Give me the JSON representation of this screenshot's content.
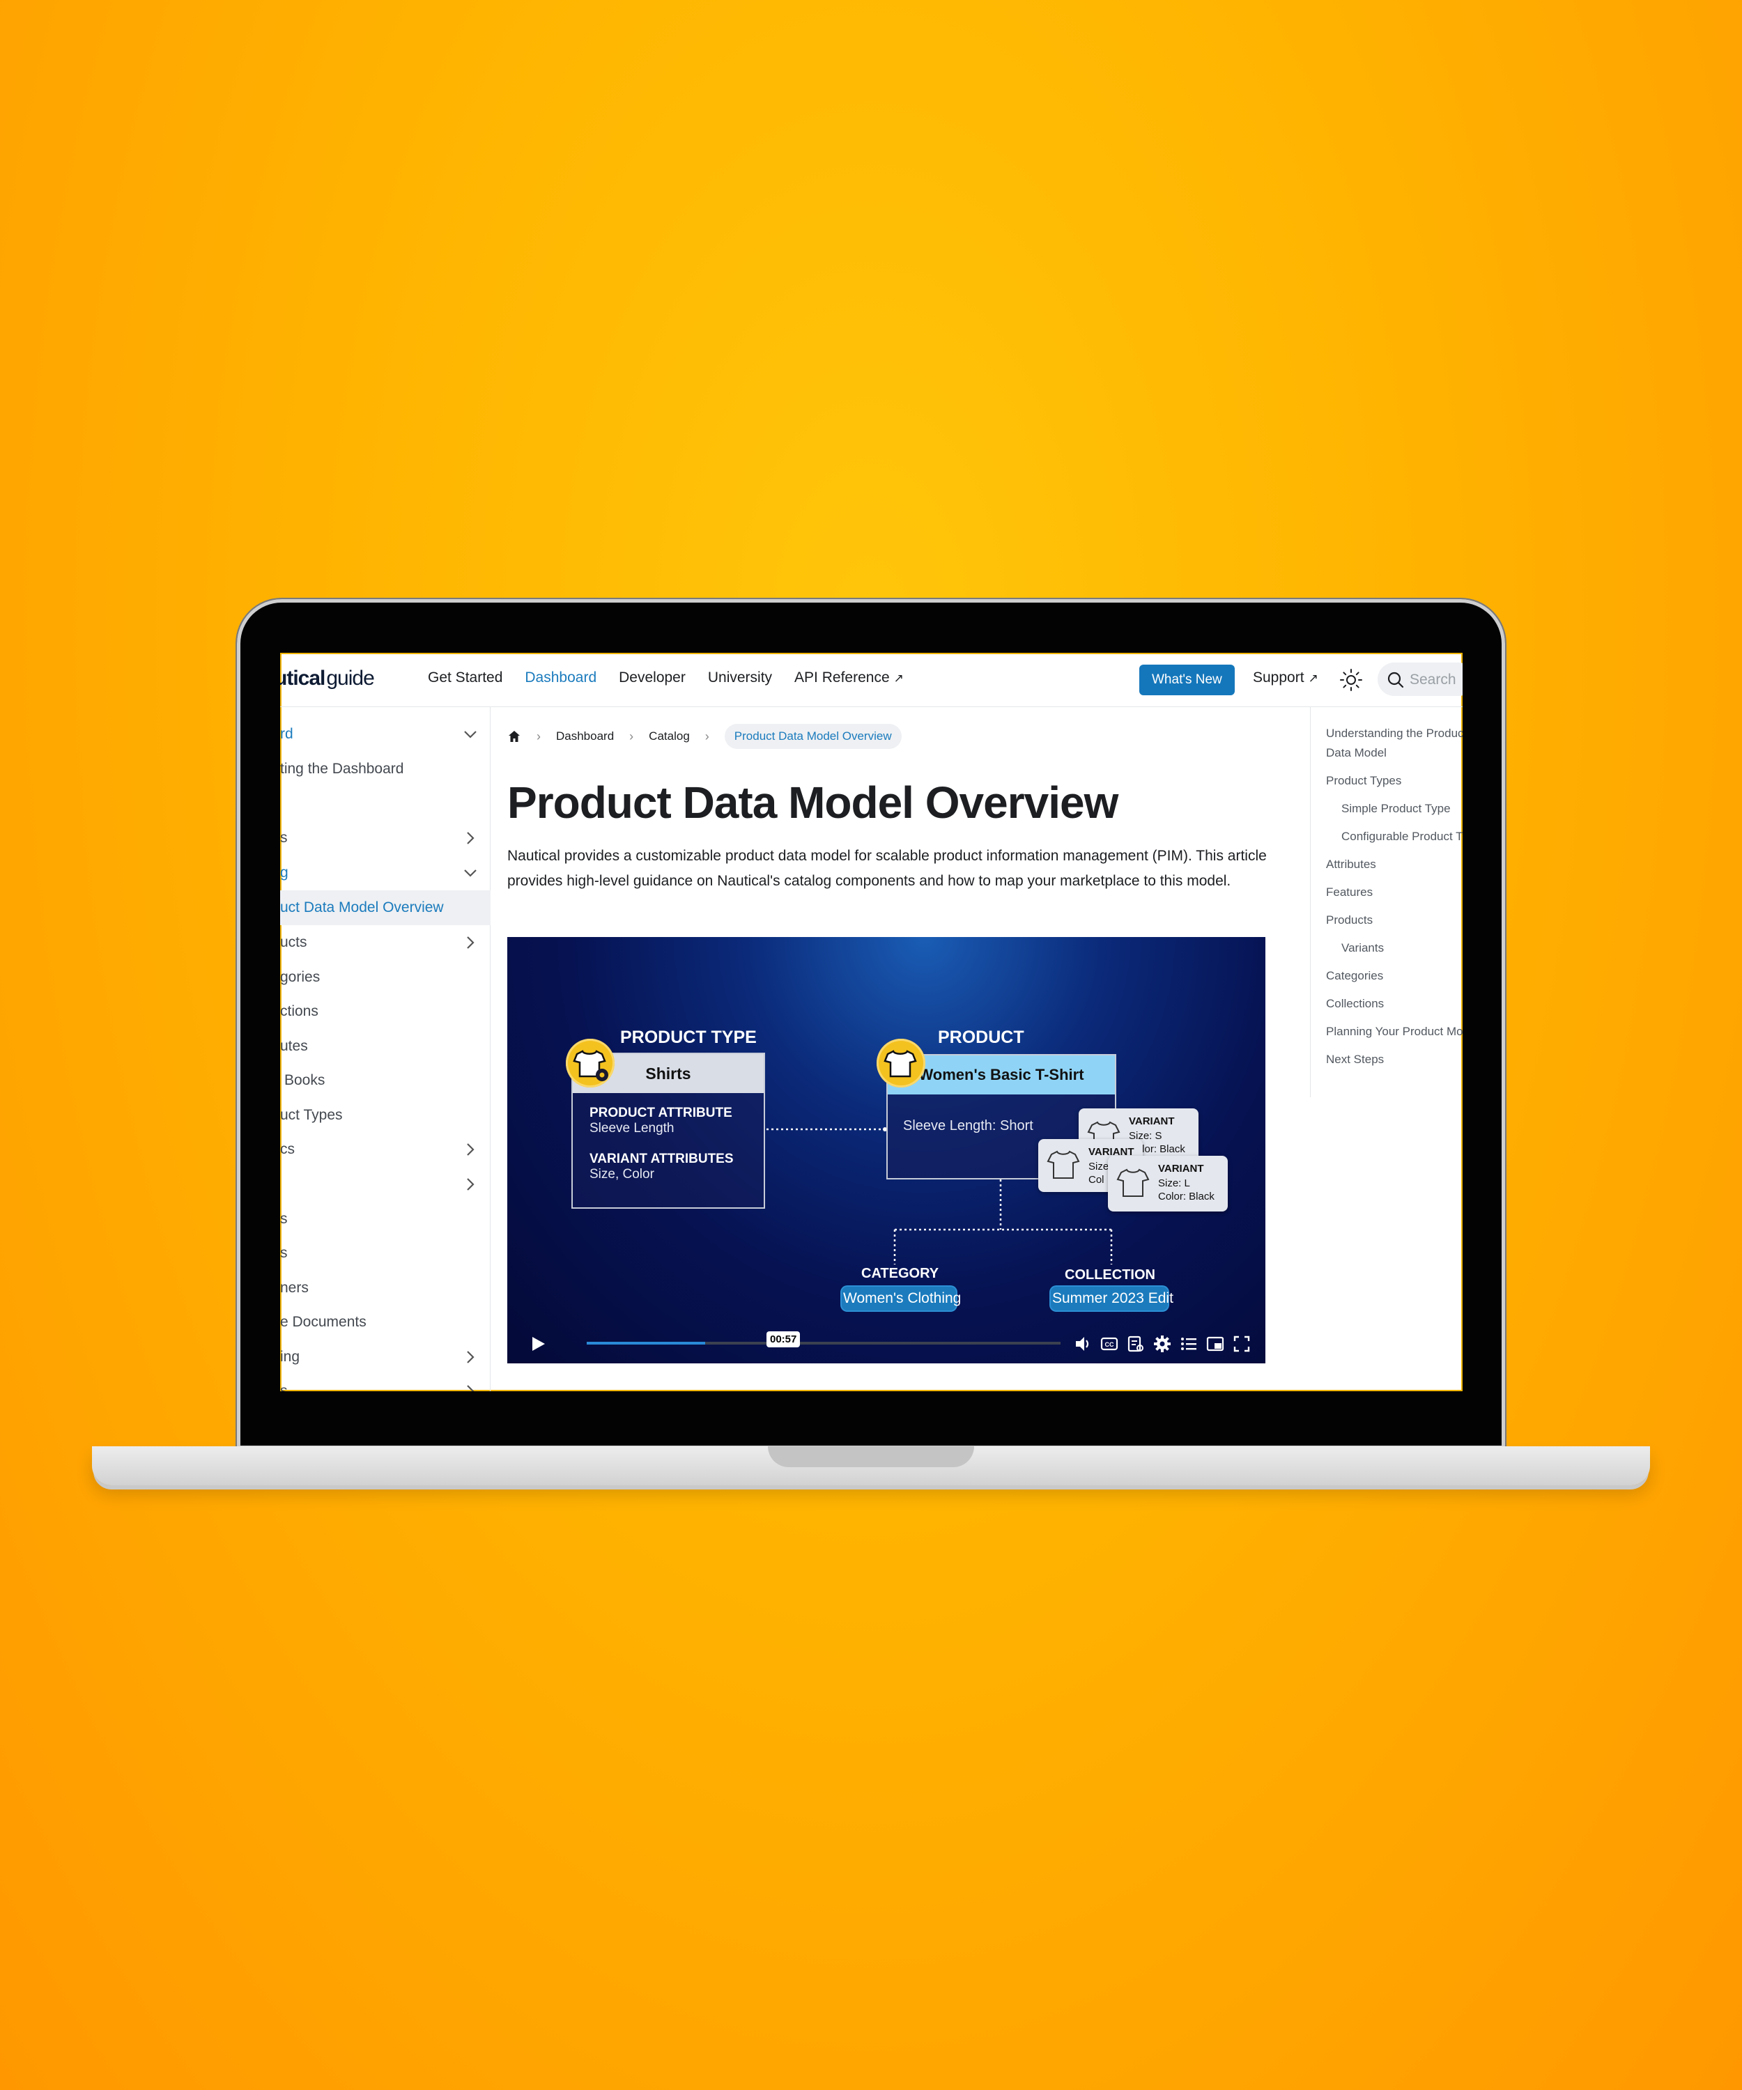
{
  "nav": {
    "logo_bold": "utical",
    "logo_rest": "guide",
    "links": [
      "Get Started",
      "Dashboard",
      "Developer",
      "University",
      "API Reference"
    ],
    "active": "Dashboard",
    "whats_new": "What's New",
    "support": "Support",
    "search_placeholder": "Search"
  },
  "sidebar": {
    "items": [
      {
        "label": "rd"
      },
      {
        "label": "ting the Dashboard"
      },
      {
        "label": "s"
      },
      {
        "label": "g"
      },
      {
        "label": "uct Data Model Overview"
      },
      {
        "label": "ucts"
      },
      {
        "label": "gories"
      },
      {
        "label": "ctions"
      },
      {
        "label": "utes"
      },
      {
        "label": "Books"
      },
      {
        "label": "uct Types"
      },
      {
        "label": "cs"
      },
      {
        "label": ""
      },
      {
        "label": "s"
      },
      {
        "label": "s"
      },
      {
        "label": "ners"
      },
      {
        "label": "e Documents"
      },
      {
        "label": "ing"
      },
      {
        "label": "s"
      }
    ]
  },
  "breadcrumb": {
    "items": [
      "Dashboard",
      "Catalog"
    ],
    "current": "Product Data Model Overview"
  },
  "page": {
    "title": "Product Data Model Overview",
    "intro": "Nautical provides a customizable product data model for scalable product information management (PIM). This article provides high-level guidance on Nautical's catalog components and how to map your marketplace to this model."
  },
  "video": {
    "product_type_label": "PRODUCT TYPE",
    "product_type_name": "Shirts",
    "product_attribute_title": "PRODUCT ATTRIBUTE",
    "product_attribute_value": "Sleeve Length",
    "variant_attributes_title": "VARIANT ATTRIBUTES",
    "variant_attributes_value": "Size, Color",
    "product_label": "PRODUCT",
    "product_name": "Women's Basic T-Shirt",
    "product_detail": "Sleeve Length: Short",
    "variants": [
      {
        "title": "VARIANT",
        "line1": "Size: S",
        "line2": "Color: Black"
      },
      {
        "title": "VARIANT",
        "line1": "Size",
        "line2": "Col"
      },
      {
        "title": "VARIANT",
        "line1": "Size: L",
        "line2": "Color: Black"
      }
    ],
    "category_label": "CATEGORY",
    "category_value": "Women's Clothing",
    "collection_label": "COLLECTION",
    "collection_value": "Summer 2023 Edit",
    "time": "00:57",
    "progress": 0.25
  },
  "toc": {
    "items": [
      {
        "label": "Understanding the Product C",
        "indent": 0
      },
      {
        "label": "Data Model",
        "indent": 0
      },
      {
        "label": "Product Types",
        "indent": 0
      },
      {
        "label": "Simple Product Type",
        "indent": 1
      },
      {
        "label": "Configurable Product Typ",
        "indent": 1
      },
      {
        "label": "Attributes",
        "indent": 0
      },
      {
        "label": "Features",
        "indent": 0
      },
      {
        "label": "Products",
        "indent": 0
      },
      {
        "label": "Variants",
        "indent": 1
      },
      {
        "label": "Categories",
        "indent": 0
      },
      {
        "label": "Collections",
        "indent": 0
      },
      {
        "label": "Planning Your Product Model",
        "indent": 0
      },
      {
        "label": "Next Steps",
        "indent": 0
      }
    ]
  },
  "colors": {
    "accent": "#1b7bbd",
    "background": "#ffb300",
    "badge": "#f4c21f"
  }
}
